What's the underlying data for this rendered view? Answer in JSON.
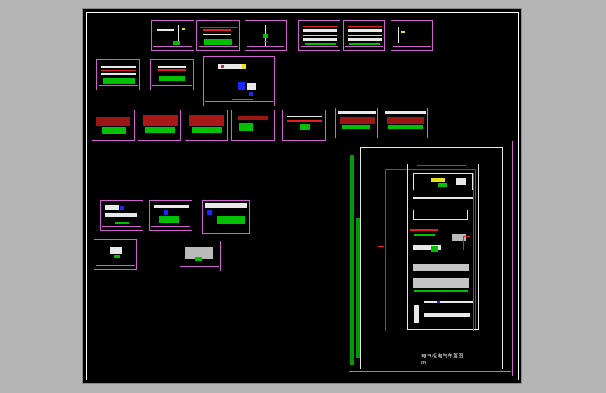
{
  "canvas": {
    "background": "#000000",
    "frame_color": "#ffffff",
    "sheet_border_color": "#d060d0"
  },
  "colors": {
    "wire": "#e02020",
    "component": "#00c000",
    "label": "#e8e8e8",
    "highlight": "#1a28ff",
    "text_yellow": "#e8e020"
  },
  "main_sheet": {
    "caption": "电气柜电气布置图",
    "caption_sub": "图"
  }
}
